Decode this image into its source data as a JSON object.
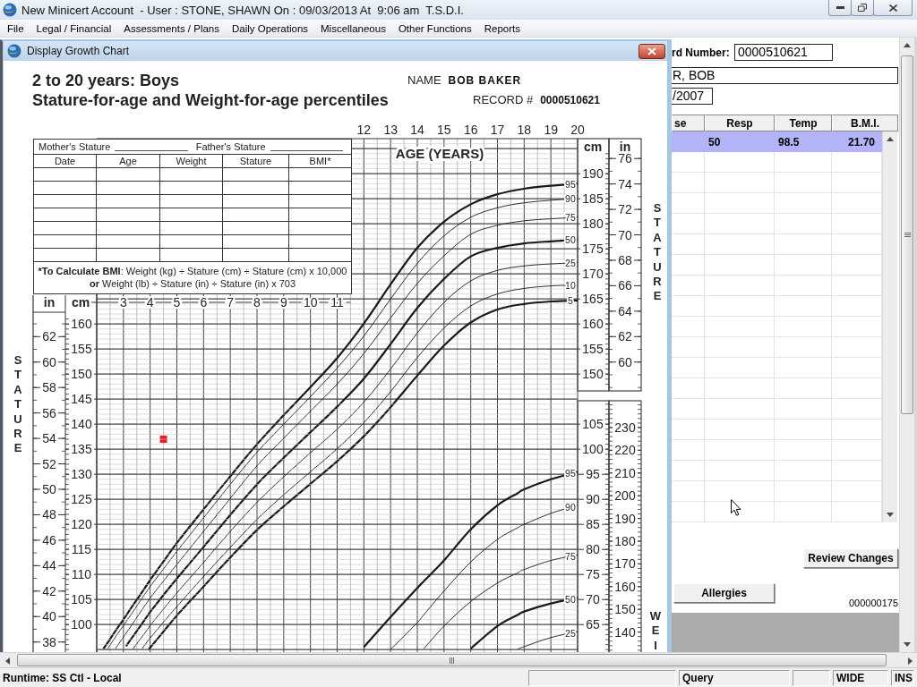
{
  "window": {
    "title": "New Minicert Account  - User : STONE, SHAWN On : 09/03/2013 At  9:06 am  T.S.D.I."
  },
  "menu": [
    "File",
    "Legal / Financial",
    "Assessments / Plans",
    "Daily Operations",
    "Miscellaneous",
    "Other Functions",
    "Reports"
  ],
  "dialog": {
    "title": "Display Growth Chart",
    "growth_chart": {
      "heading": "2 to 20 years: Boys",
      "subheading": "Stature-for-age and Weight-for-age percentiles",
      "name_label": "NAME",
      "name_value": "BOB BAKER",
      "record_label": "RECORD #",
      "record_value": "0000510621",
      "measurement_table": {
        "mothers_stature_label": "Mother's Stature",
        "fathers_stature_label": "Father's Stature",
        "columns": [
          "Date",
          "Age",
          "Weight",
          "Stature",
          "BMI*"
        ],
        "formula_lines": [
          {
            "lead": "*To Calculate BMI",
            "text": ": Weight (kg) ÷ Stature (cm) ÷ Stature (cm) x 10,000"
          },
          {
            "lead": "or",
            "text": " Weight (lb) ÷ Stature (in) ÷ Stature (in) x 703"
          }
        ]
      },
      "stature": {
        "left_units": [
          "in",
          "cm"
        ],
        "right_units": [
          "cm",
          "in"
        ],
        "lower_age_ticks": [
          "3",
          "4",
          "5",
          "6",
          "7",
          "8",
          "9",
          "10",
          "11"
        ],
        "left_inch_ticks": [
          "62",
          "60",
          "58",
          "56",
          "54",
          "52",
          "50",
          "48",
          "46",
          "44",
          "42",
          "40",
          "38"
        ],
        "right_cm_ticks": [
          "190",
          "185",
          "180",
          "175",
          "170",
          "165",
          "160",
          "155",
          "150"
        ],
        "right_inch_ticks": [
          "76",
          "74",
          "72",
          "70",
          "68",
          "66",
          "64",
          "62",
          "60"
        ],
        "right_axis_title": "STATURE",
        "chart_data": {
          "type": "line",
          "xlabel": "AGE (YEARS)",
          "ylabel": "STATURE",
          "grid": true,
          "x": [
            2.25,
            2.4,
            2.7,
            3,
            3.1,
            3.35,
            3.7,
            3.95,
            4,
            4.5,
            5,
            6,
            7,
            8,
            9,
            10,
            11,
            12,
            13,
            14,
            15,
            16,
            17,
            18,
            19,
            20
          ],
          "xlim": [
            2,
            20
          ],
          "ylim": [
            95,
            197
          ],
          "xticks": [
            12,
            13,
            14,
            15,
            16,
            17,
            18,
            19,
            20
          ],
          "yticks": [
            100,
            105,
            110,
            115,
            120,
            125,
            130,
            135,
            140,
            145,
            150,
            155,
            160
          ],
          "series": [
            {
              "name": "95",
              "color": "#1a1a1a",
              "values": [
                95.2,
                96.3,
                98.7,
                101.0,
                101.8,
                103.8,
                106.5,
                108.5,
                108.9,
                112.6,
                116.3,
                123.0,
                129.6,
                136.0,
                141.8,
                147.4,
                153.2,
                160.1,
                167.9,
                175.2,
                180.4,
                183.9,
                185.9,
                187.0,
                187.6,
                188.0
              ]
            },
            {
              "name": "90",
              "color": "#1a1a1a",
              "values": [
                null,
                95.1,
                97.5,
                99.8,
                100.6,
                102.5,
                105.3,
                107.2,
                107.6,
                111.1,
                114.6,
                121.3,
                128.0,
                134.4,
                140.0,
                145.5,
                151.2,
                157.6,
                165.0,
                172.1,
                177.6,
                181.3,
                183.2,
                184.2,
                184.7,
                185.0
              ]
            },
            {
              "name": "75",
              "color": "#1a1a1a",
              "values": [
                null,
                null,
                95.2,
                97.5,
                98.3,
                100.2,
                103.0,
                104.9,
                105.3,
                108.7,
                112.0,
                118.6,
                125.2,
                131.7,
                137.2,
                142.6,
                148.0,
                154.1,
                161.2,
                168.1,
                173.6,
                177.9,
                179.7,
                180.6,
                181.0,
                181.3
              ]
            },
            {
              "name": "50",
              "color": "#1a1a1a",
              "values": [
                null,
                null,
                null,
                null,
                95.7,
                97.6,
                100.2,
                102.1,
                102.5,
                105.9,
                109.2,
                115.5,
                121.9,
                128.0,
                133.3,
                138.4,
                143.5,
                149.1,
                156.0,
                163.2,
                169.0,
                173.5,
                175.2,
                176.1,
                176.5,
                176.8
              ]
            },
            {
              "name": "25",
              "color": "#1a1a1a",
              "values": [
                null,
                null,
                null,
                null,
                null,
                95.1,
                97.6,
                99.4,
                99.8,
                103.1,
                106.3,
                112.4,
                118.6,
                124.4,
                129.5,
                134.3,
                139.0,
                144.4,
                151.0,
                158.2,
                164.3,
                168.6,
                170.7,
                171.6,
                172.0,
                172.2
              ]
            },
            {
              "name": "10",
              "color": "#1a1a1a",
              "values": [
                null,
                null,
                null,
                null,
                null,
                null,
                95.2,
                97.0,
                97.3,
                100.5,
                103.6,
                109.6,
                115.4,
                121.0,
                125.9,
                130.5,
                135.1,
                140.3,
                146.5,
                153.3,
                159.2,
                163.6,
                166.0,
                167.1,
                167.6,
                167.8
              ]
            },
            {
              "name": "5",
              "color": "#1a1a1a",
              "values": [
                null,
                null,
                null,
                null,
                null,
                null,
                null,
                95.1,
                95.4,
                98.6,
                101.8,
                107.6,
                113.4,
                118.9,
                123.6,
                128.1,
                132.6,
                137.6,
                143.4,
                149.7,
                155.7,
                160.3,
                162.9,
                164.0,
                164.5,
                164.7
              ]
            },
            {
              "color": "#ee1c24",
              "marker": "square",
              "values": [
                null,
                null,
                null,
                null,
                null,
                null,
                null,
                null,
                null,
                137.0,
                null,
                null,
                null,
                null,
                null,
                null,
                null,
                null,
                null,
                null,
                null,
                null,
                null,
                null,
                null,
                null
              ]
            }
          ]
        }
      },
      "weight": {
        "pound_ticks": [
          "230",
          "220",
          "210",
          "200",
          "190",
          "180",
          "170",
          "160",
          "150",
          "140"
        ],
        "chart_data": {
          "type": "line",
          "ylabel": "WEI",
          "grid": true,
          "x": [
            12,
            13,
            14,
            14.25,
            15,
            16,
            17,
            17.75,
            18,
            19,
            20
          ],
          "xlim": [
            2,
            20
          ],
          "ylim": [
            60,
            105
          ],
          "yticks": [
            65,
            70,
            75,
            80,
            85,
            90,
            95,
            100,
            105
          ],
          "series": [
            {
              "name": "95",
              "color": "#1a1a1a",
              "values": [
                60.5,
                66.5,
                72.3,
                73.7,
                77.8,
                84.0,
                88.8,
                91.2,
                92.0,
                94.0,
                95.5
              ]
            },
            {
              "name": "90",
              "color": "#1a1a1a",
              "values": [
                null,
                60.0,
                65.4,
                67.0,
                71.7,
                77.5,
                82.0,
                84.3,
                85.0,
                87.2,
                88.8
              ]
            },
            {
              "name": "75",
              "color": "#1a1a1a",
              "values": [
                null,
                null,
                null,
                60.2,
                64.7,
                69.6,
                73.3,
                75.3,
                76.0,
                77.8,
                78.9
              ]
            },
            {
              "name": "50",
              "color": "#1a1a1a",
              "values": [
                null,
                null,
                null,
                null,
                null,
                60.2,
                64.7,
                66.9,
                67.6,
                69.2,
                70.3
              ]
            },
            {
              "name": "25",
              "color": "#1a1a1a",
              "values": [
                null,
                null,
                null,
                null,
                null,
                null,
                null,
                60.1,
                60.6,
                62.4,
                63.6
              ]
            }
          ]
        }
      }
    }
  },
  "record_form": {
    "record_number_label": "rd Number:",
    "record_number": "0000510621",
    "patient_name": "R, BOB",
    "date": "/2007",
    "table": {
      "columns": [
        "se",
        "Resp",
        "Temp",
        "B.M.I."
      ],
      "rows": [
        {
          "cells": [
            "",
            "50",
            "98.5",
            "21.70"
          ],
          "selected": true
        }
      ]
    },
    "review_button": "Review Changes",
    "allergies_button": "Allergies",
    "code": "000000175"
  },
  "status_bar": {
    "runtime": "Runtime: SS Ctl - Local",
    "panels": [
      "Query",
      "WIDE",
      "INS"
    ]
  }
}
